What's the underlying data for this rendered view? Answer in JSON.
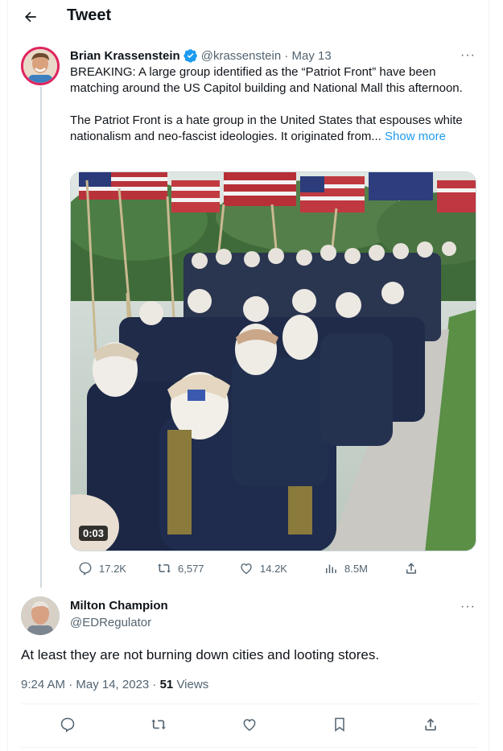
{
  "header": {
    "title": "Tweet",
    "back_icon": "arrow-left-icon"
  },
  "tweet1": {
    "author_name": "Brian Krassenstein",
    "verified_icon": "verified-badge-icon",
    "handle": "@krassenstein",
    "separator": " · ",
    "date": "May 13",
    "more": "···",
    "paragraph1": "BREAKING: A large group identified as the “Patriot Front” have been matching around the US Capitol building and National Mall this afternoon.",
    "paragraph2": "The Patriot Front is a hate group in the United States that espouses white nationalism and neo-fascist ideologies. It originated from...",
    "show_more": "Show more",
    "video_duration": "0:03",
    "stats": {
      "replies": "17.2K",
      "retweets": "6,577",
      "likes": "14.2K",
      "views": "8.5M"
    }
  },
  "tweet2": {
    "author_name": "Milton Champion",
    "handle": "@EDRegulator",
    "more": "···",
    "text": "At least they are not burning down cities and looting stores.",
    "time": "9:24 AM · May 14, 2023 · ",
    "views_count": "51",
    "views_label": " Views"
  },
  "colors": {
    "accent": "#1d9bf0",
    "muted": "#536471",
    "text": "#0f1419",
    "border": "#eff3f4"
  }
}
